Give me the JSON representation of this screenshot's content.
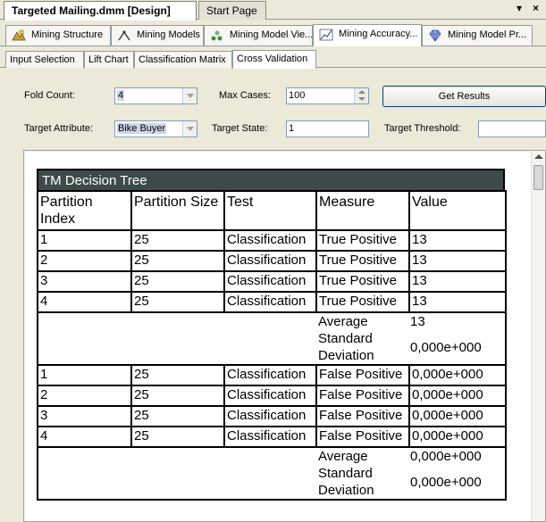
{
  "document_tabs": {
    "active": "Targeted Mailing.dmm [Design]",
    "inactive": "Start Page",
    "pin_glyph": "▾",
    "close_glyph": "×"
  },
  "designer_tabs": [
    {
      "label": "Mining Structure",
      "icon": "structure-icon"
    },
    {
      "label": "Mining Models",
      "icon": "models-icon"
    },
    {
      "label": "Mining Model Vie...",
      "icon": "viewer-icon"
    },
    {
      "label": "Mining Accuracy...",
      "icon": "accuracy-chart-icon"
    },
    {
      "label": "Mining Model Pr...",
      "icon": "prediction-gem-icon"
    }
  ],
  "view_tabs": [
    "Input Selection",
    "Lift Chart",
    "Classification Matrix",
    "Cross Validation"
  ],
  "params": {
    "fold_count_label": "Fold Count:",
    "fold_count_value": "4",
    "max_cases_label": "Max Cases:",
    "max_cases_value": "100",
    "get_results_label": "Get Results",
    "target_attribute_label": "Target Attribute:",
    "target_attribute_value": "Bike Buyer",
    "target_state_label": "Target State:",
    "target_state_value": "1",
    "target_threshold_label": "Target Threshold:",
    "target_threshold_value": ""
  },
  "report": {
    "title": "TM Decision Tree",
    "columns": [
      "Partition Index",
      "Partition Size",
      "Test",
      "Measure",
      "Value"
    ],
    "groups": [
      {
        "rows": [
          [
            "1",
            "25",
            "Classification",
            "True Positive",
            "13"
          ],
          [
            "2",
            "25",
            "Classification",
            "True Positive",
            "13"
          ],
          [
            "3",
            "25",
            "Classification",
            "True Positive",
            "13"
          ],
          [
            "4",
            "25",
            "Classification",
            "True Positive",
            "13"
          ]
        ],
        "summary": {
          "average_label": "Average",
          "average_value": "13",
          "stddev_label": "Standard Deviation",
          "stddev_value": "0,000e+000"
        }
      },
      {
        "rows": [
          [
            "1",
            "25",
            "Classification",
            "False Positive",
            "0,000e+000"
          ],
          [
            "2",
            "25",
            "Classification",
            "False Positive",
            "0,000e+000"
          ],
          [
            "3",
            "25",
            "Classification",
            "False Positive",
            "0,000e+000"
          ],
          [
            "4",
            "25",
            "Classification",
            "False Positive",
            "0,000e+000"
          ]
        ],
        "summary": {
          "average_label": "Average",
          "average_value": "0,000e+000",
          "stddev_label": "Standard Deviation",
          "stddev_value": "0,000e+000"
        }
      }
    ]
  }
}
